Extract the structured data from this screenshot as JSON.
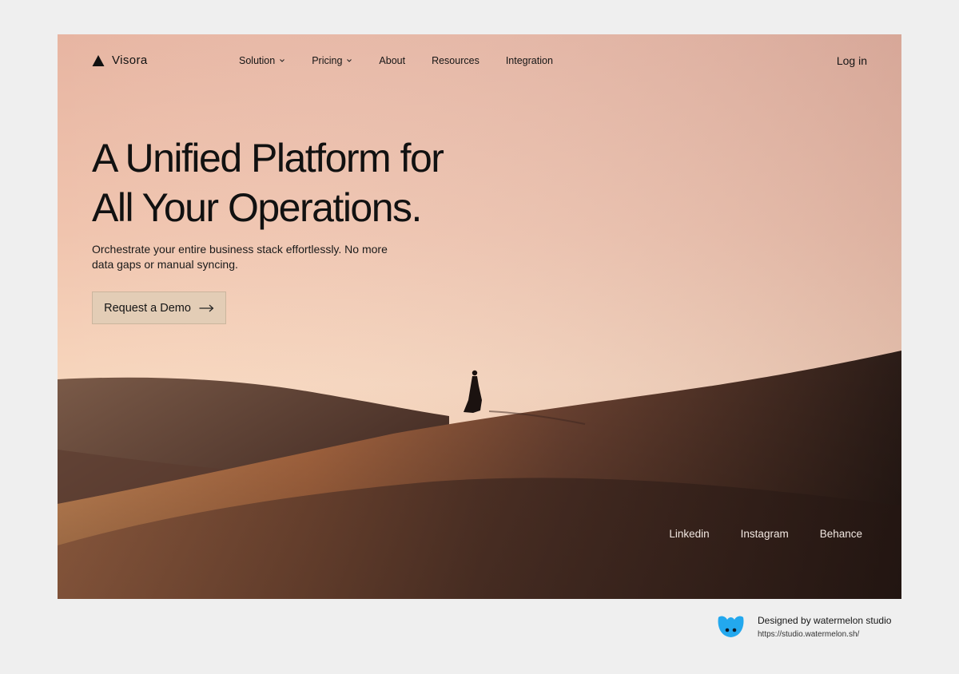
{
  "brand": {
    "name": "Visora",
    "logo_icon": "triangle-icon"
  },
  "nav": {
    "items": [
      {
        "label": "Solution",
        "has_dropdown": true
      },
      {
        "label": "Pricing",
        "has_dropdown": true
      },
      {
        "label": "About",
        "has_dropdown": false
      },
      {
        "label": "Resources",
        "has_dropdown": false
      },
      {
        "label": "Integration",
        "has_dropdown": false
      }
    ],
    "login_label": "Log in"
  },
  "hero": {
    "headline_line1": "A Unified Platform for",
    "headline_line2": "All Your Operations.",
    "subtext": "Orchestrate your entire business stack effortlessly. No more data gaps or manual syncing.",
    "cta_label": "Request a Demo",
    "cta_icon": "arrow-right-icon"
  },
  "socials": [
    "Linkedin",
    "Instagram",
    "Behance"
  ],
  "credit": {
    "title": "Designed by watermelon studio",
    "url": "https://studio.watermelon.sh/"
  },
  "colors": {
    "page_bg": "#efefef",
    "sky_top": "#e8b7a3",
    "sky_glow": "#f6d2bb",
    "dune_dark": "#2a1a15",
    "cta_bg": "#e3cdb6",
    "studio_blue": "#23a8ee"
  }
}
